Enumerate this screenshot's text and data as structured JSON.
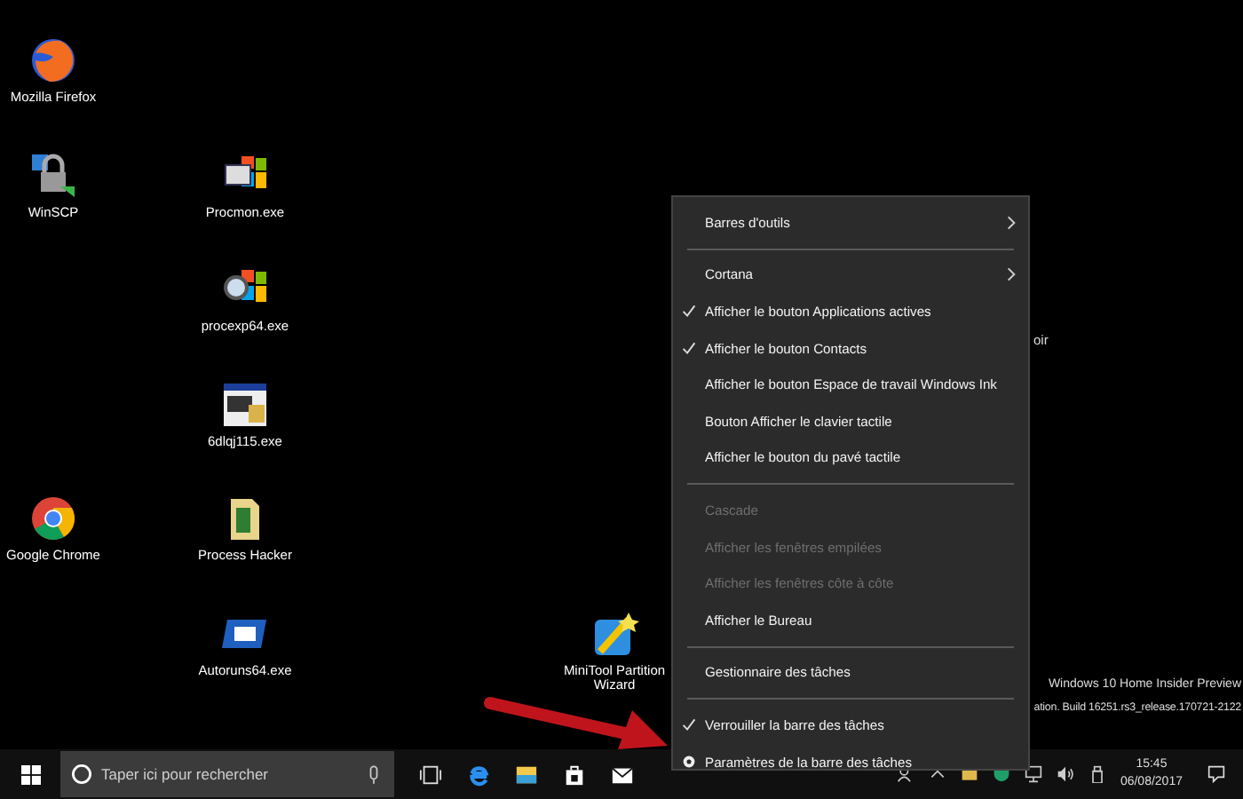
{
  "desktop": {
    "columns": [
      [
        {
          "label": "Mozilla Firefox",
          "kind": "firefox"
        },
        {
          "label": "WinSCP",
          "kind": "winscp"
        },
        null,
        null,
        {
          "label": "Google Chrome",
          "kind": "chrome"
        },
        null
      ],
      [
        null,
        {
          "label": "Procmon.exe",
          "kind": "procmon"
        },
        {
          "label": "procexp64.exe",
          "kind": "procexp"
        },
        {
          "label": "6dlqj115.exe",
          "kind": "setup"
        },
        {
          "label": "Process Hacker",
          "kind": "folder"
        },
        {
          "label": "Autoruns64.exe",
          "kind": "autoruns"
        }
      ],
      [
        null,
        null,
        null,
        null,
        null,
        null
      ],
      [
        null,
        null,
        null,
        null,
        null,
        {
          "label": "MiniTool Partition Wizard",
          "kind": "minitool"
        }
      ]
    ],
    "fragment": "oir",
    "watermark": [
      "Windows 10 Home Insider Preview",
      "ation. Build 16251.rs3_release.170721-2122"
    ]
  },
  "context_menu": {
    "groups": [
      [
        {
          "label": "Barres d'outils",
          "kind": "submenu",
          "checked": false,
          "disabled": false
        }
      ],
      [
        {
          "label": "Cortana",
          "kind": "submenu",
          "checked": false,
          "disabled": false
        },
        {
          "label": "Afficher le bouton Applications actives",
          "kind": "option",
          "checked": true,
          "disabled": false
        },
        {
          "label": "Afficher le bouton Contacts",
          "kind": "option",
          "checked": true,
          "disabled": false
        },
        {
          "label": "Afficher le bouton Espace de travail Windows Ink",
          "kind": "option",
          "checked": false,
          "disabled": false
        },
        {
          "label": "Bouton Afficher le clavier tactile",
          "kind": "option",
          "checked": false,
          "disabled": false
        },
        {
          "label": "Afficher le bouton du pavé tactile",
          "kind": "option",
          "checked": false,
          "disabled": false
        }
      ],
      [
        {
          "label": "Cascade",
          "kind": "option",
          "checked": false,
          "disabled": true
        },
        {
          "label": "Afficher les fenêtres empilées",
          "kind": "option",
          "checked": false,
          "disabled": true
        },
        {
          "label": "Afficher les fenêtres côte à côte",
          "kind": "option",
          "checked": false,
          "disabled": true
        },
        {
          "label": "Afficher le Bureau",
          "kind": "option",
          "checked": false,
          "disabled": false
        }
      ],
      [
        {
          "label": "Gestionnaire des tâches",
          "kind": "option",
          "checked": false,
          "disabled": false
        }
      ],
      [
        {
          "label": "Verrouiller la barre des tâches",
          "kind": "option",
          "checked": true,
          "disabled": false
        },
        {
          "label": "Paramètres de la barre des tâches",
          "kind": "settings",
          "checked": false,
          "disabled": false
        }
      ]
    ]
  },
  "taskbar": {
    "search": {
      "placeholder": "Taper ici pour rechercher"
    },
    "clock": {
      "time": "15:45",
      "date": "06/08/2017"
    }
  }
}
